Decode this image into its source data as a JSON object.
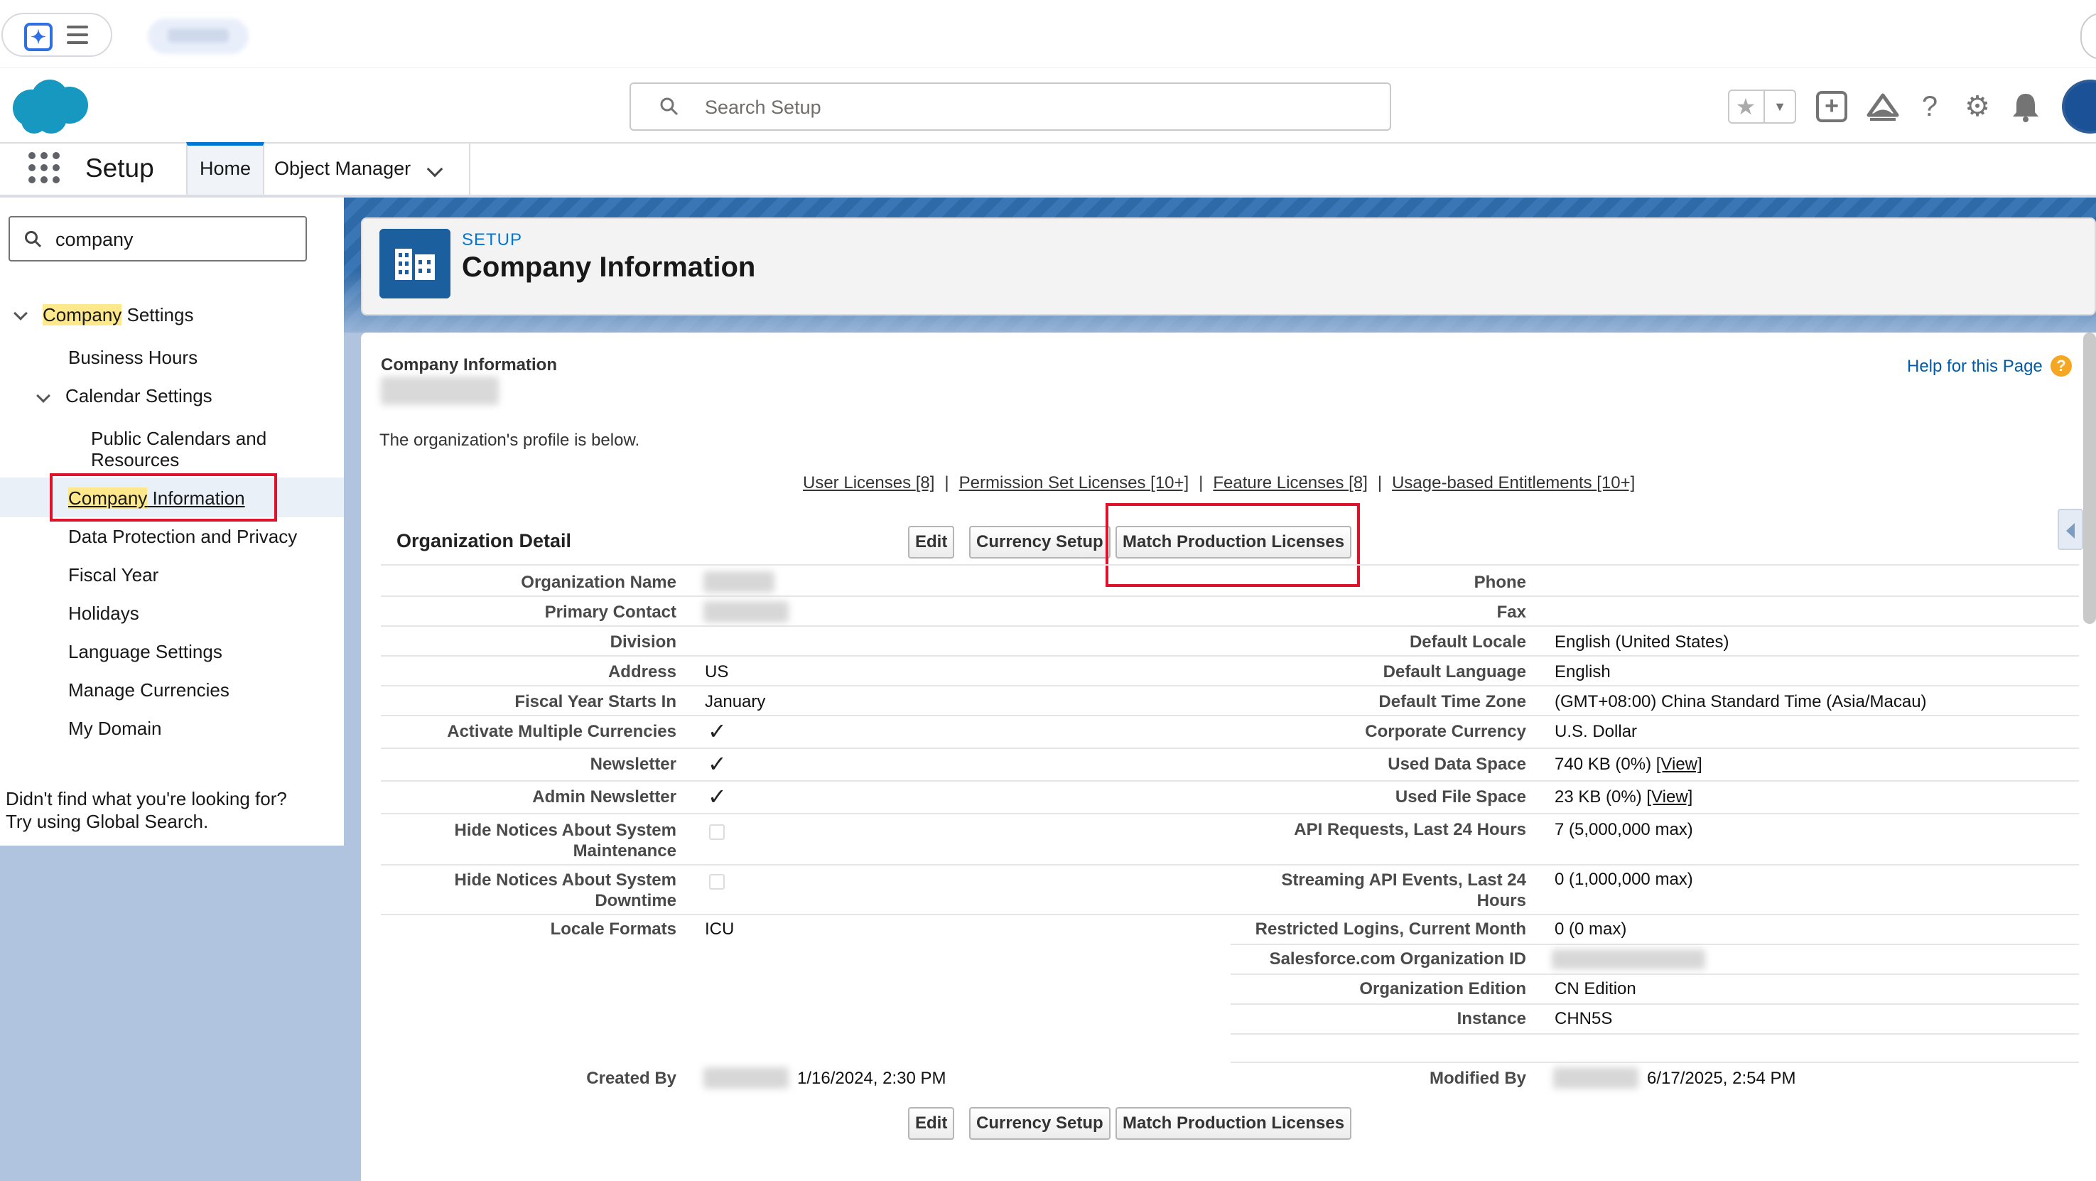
{
  "header": {
    "search_placeholder": "Search Setup",
    "icons": [
      "favorites-star-icon",
      "favorites-caret-icon",
      "add-icon",
      "trailhead-icon",
      "help-icon",
      "setup-gear-icon",
      "notifications-bell-icon"
    ]
  },
  "nav": {
    "app_name": "Setup",
    "tabs": [
      {
        "label": "Home"
      },
      {
        "label": "Object Manager"
      }
    ]
  },
  "sidebar": {
    "quickfind_value": "company",
    "section_highlight": "Company",
    "section_rest": " Settings",
    "items": [
      {
        "label": "Business Hours"
      },
      {
        "label": "Calendar Settings"
      },
      {
        "label": "Public Calendars and Resources"
      },
      {
        "label": "Company Information"
      },
      {
        "label": "Data Protection and Privacy"
      },
      {
        "label": "Fiscal Year"
      },
      {
        "label": "Holidays"
      },
      {
        "label": "Language Settings"
      },
      {
        "label": "Manage Currencies"
      },
      {
        "label": "My Domain"
      }
    ],
    "selected_highlight": "Company",
    "selected_rest": " Information",
    "not_found_line1": "Didn't find what you're looking for?",
    "not_found_line2": "Try using Global Search."
  },
  "page_header": {
    "eyebrow": "SETUP",
    "title": "Company Information"
  },
  "main": {
    "section_label": "Company Information",
    "help_link": "Help for this Page",
    "profile_note": "The organization's profile is below.",
    "license_links": [
      {
        "label": "User Licenses",
        "count": "[8]"
      },
      {
        "label": "Permission Set Licenses",
        "count": "[10+]"
      },
      {
        "label": "Feature Licenses",
        "count": "[8]"
      },
      {
        "label": "Usage-based Entitlements",
        "count": "[10+]"
      }
    ],
    "detail_title": "Organization Detail",
    "buttons": {
      "edit": "Edit",
      "currency_setup": "Currency Setup",
      "match_licenses": "Match Production Licenses"
    },
    "left_fields": {
      "organization_name": {
        "label": "Organization Name",
        "value": ""
      },
      "primary_contact": {
        "label": "Primary Contact",
        "value": ""
      },
      "division": {
        "label": "Division",
        "value": ""
      },
      "address": {
        "label": "Address",
        "value": "US"
      },
      "fiscal_year": {
        "label": "Fiscal Year Starts In",
        "value": "January"
      },
      "multi_currency": {
        "label": "Activate Multiple Currencies",
        "checked": true
      },
      "newsletter": {
        "label": "Newsletter",
        "checked": true
      },
      "admin_newsletter": {
        "label": "Admin Newsletter",
        "checked": true
      },
      "hide_maintenance": {
        "label_line1": "Hide Notices About System",
        "label_line2": "Maintenance",
        "checked": false
      },
      "hide_downtime": {
        "label_line1": "Hide Notices About System",
        "label_line2": "Downtime",
        "checked": false
      },
      "locale_formats": {
        "label": "Locale Formats",
        "value": "ICU"
      }
    },
    "right_fields": {
      "phone": {
        "label": "Phone",
        "value": ""
      },
      "fax": {
        "label": "Fax",
        "value": ""
      },
      "default_locale": {
        "label": "Default Locale",
        "value": "English (United States)"
      },
      "default_language": {
        "label": "Default Language",
        "value": "English"
      },
      "default_time_zone": {
        "label": "Default Time Zone",
        "value": "(GMT+08:00) China Standard Time (Asia/Macau)"
      },
      "corporate_currency": {
        "label": "Corporate Currency",
        "value": "U.S. Dollar"
      },
      "used_data_space": {
        "label": "Used Data Space",
        "value": "740 KB (0%)",
        "link": "[View]"
      },
      "used_file_space": {
        "label": "Used File Space",
        "value": "23 KB (0%)",
        "link": "[View]"
      },
      "api_requests": {
        "label": "API Requests, Last 24 Hours",
        "value": "7 (5,000,000 max)"
      },
      "streaming_events": {
        "label_line1": "Streaming API Events, Last 24",
        "label_line2": "Hours",
        "value": "0 (1,000,000 max)"
      },
      "restricted_logins": {
        "label": "Restricted Logins, Current Month",
        "value": "0 (0 max)"
      },
      "org_id": {
        "label": "Salesforce.com Organization ID",
        "value": ""
      },
      "org_edition": {
        "label": "Organization Edition",
        "value": "CN Edition"
      },
      "instance": {
        "label": "Instance",
        "value": "CHN5S"
      }
    },
    "created_by": {
      "label": "Created By",
      "date": "1/16/2024, 2:30 PM"
    },
    "modified_by": {
      "label": "Modified By",
      "date": "6/17/2025, 2:54 PM"
    }
  },
  "colors": {
    "brand_blue": "#0176d3",
    "highlight_red": "#e0112b",
    "search_highlight": "#fde98c"
  }
}
